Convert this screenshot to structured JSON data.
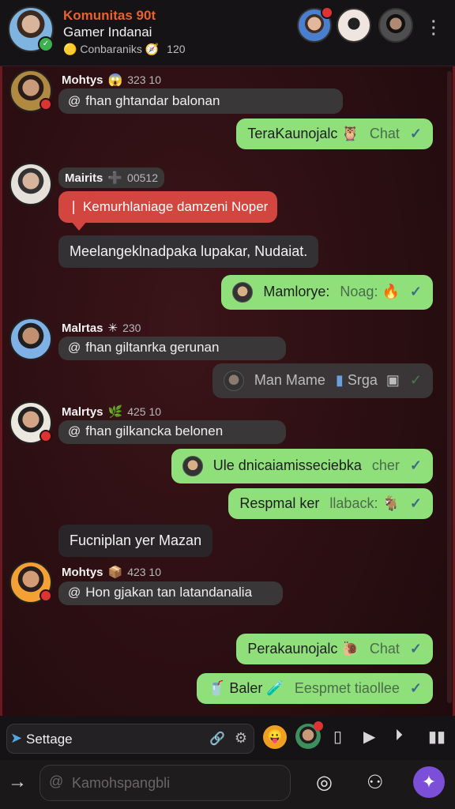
{
  "header": {
    "title": "Komunitas 90t",
    "subtitle": "Gamer Indanai",
    "meta_label": "Conbaraniks",
    "meta_count": "120",
    "meta_emoji": "🧭"
  },
  "messages": [
    {
      "type": "in",
      "name": "Mohtys",
      "emoji": "😱",
      "meta": "323 10",
      "text": "fhan ghtandar balonan"
    },
    {
      "type": "out",
      "text": "TeraKaunojalc",
      "emoji": "🦉",
      "dim": "Chat"
    },
    {
      "type": "in",
      "name": "Mairits",
      "emoji": "➕",
      "meta": "00512",
      "red_text": "Kemurhlaniage damzeni Noper",
      "dark_text": "Meelangeklnadpaka lupakar, Nudaiat."
    },
    {
      "type": "out",
      "text": "Mamlorye:",
      "dim": "Noag:",
      "emoji": "🔥"
    },
    {
      "type": "in",
      "name": "Malrtas",
      "emoji": "✳",
      "meta": "230",
      "text": "fhan giltanrka gerunan"
    },
    {
      "type": "grey",
      "text": "Man Mame",
      "text2": "Srga"
    },
    {
      "type": "in",
      "name": "Malrtys",
      "emoji": "🌿",
      "meta": "425 10",
      "text": "fhan gilkancka belonen"
    },
    {
      "type": "out",
      "text": "Ule dnicaiamisseciebka",
      "dim": "cher"
    },
    {
      "type": "out",
      "text": "Respmal ker",
      "dim": "llaback:",
      "emoji": "🐐"
    },
    {
      "type": "dark",
      "text": "Fucniplan yer Mazan"
    },
    {
      "type": "in",
      "name": "Mohtys",
      "emoji": "📦",
      "meta": "423 10",
      "text": "Hon gjakan tan latandanalia"
    },
    {
      "type": "out",
      "text": "Perakaunojalc",
      "emoji": "🐌",
      "dim": "Chat"
    },
    {
      "type": "out",
      "text": "Baler",
      "emoji": "🧪",
      "dim": "Eespmet tiaollee"
    }
  ],
  "compose": {
    "label": "Settage"
  },
  "input": {
    "placeholder": "Kamohspangbli"
  },
  "colors": {
    "accent": "#e8622a",
    "out_bubble": "#8fe07a",
    "alert_bubble": "#d2463f",
    "fab": "#7b4fd8"
  }
}
